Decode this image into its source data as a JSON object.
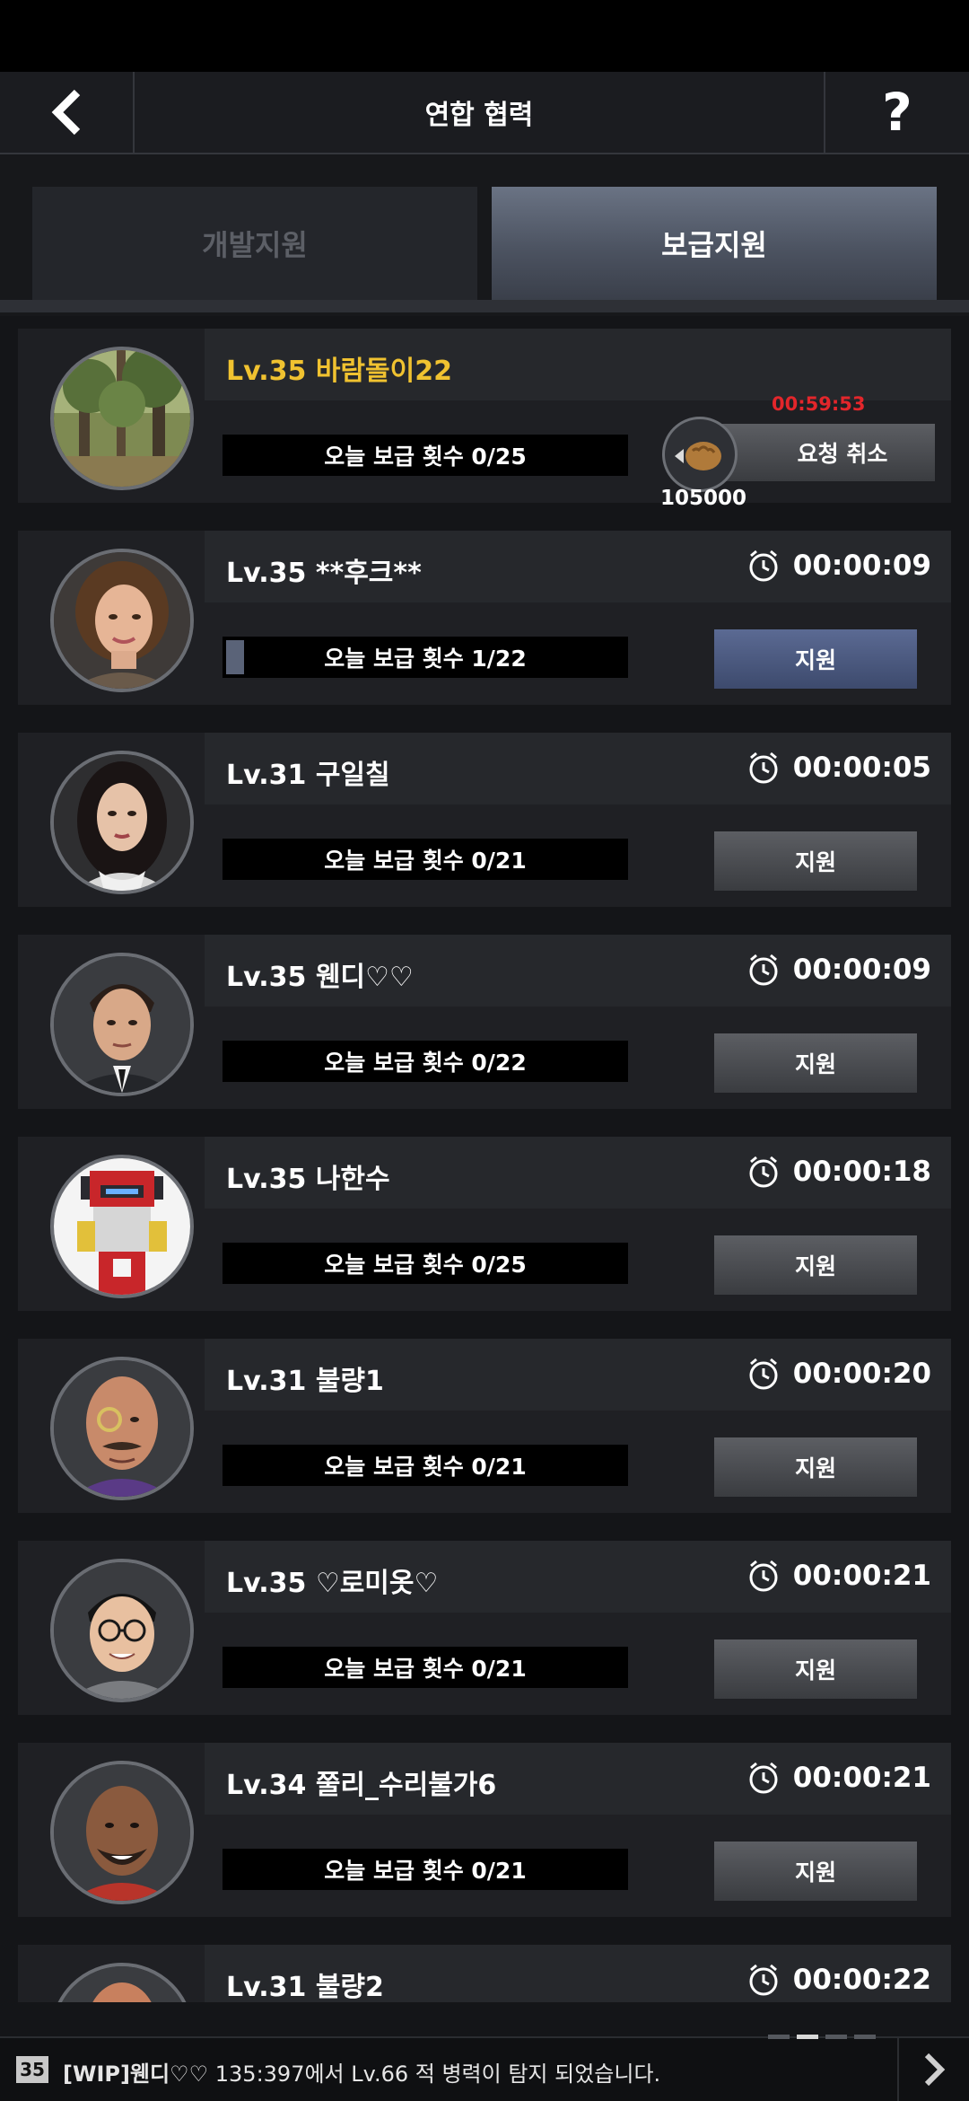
{
  "header": {
    "title": "연합 협력",
    "help_label": "?"
  },
  "tabs": [
    {
      "label": "개발지원",
      "active": false
    },
    {
      "label": "보급지원",
      "active": true
    }
  ],
  "requests": [
    {
      "name": "Lv.35 바람돌이22",
      "highlight": true,
      "progress": "오늘 보급 횟수 0/25",
      "progress_fraction": 0,
      "countdown": "00:59:53",
      "resource_amount": "105000",
      "action": "요청 취소",
      "avatar": "forest-avatar"
    },
    {
      "name": "Lv.35 **후크**",
      "timer": "00:00:09",
      "progress": "오늘 보급 횟수 1/22",
      "progress_fraction": 0.045,
      "action": "지원",
      "action_style": "blue",
      "avatar": "woman-brown-hair-avatar"
    },
    {
      "name": "Lv.31 구일칠",
      "timer": "00:00:05",
      "progress": "오늘 보급 횟수 0/21",
      "progress_fraction": 0,
      "action": "지원",
      "avatar": "woman-dark-hair-avatar"
    },
    {
      "name": "Lv.35 웬디♡♡",
      "timer": "00:00:09",
      "progress": "오늘 보급 횟수 0/22",
      "progress_fraction": 0,
      "action": "지원",
      "avatar": "man-suit-avatar"
    },
    {
      "name": "Lv.35 나한수",
      "timer": "00:00:18",
      "progress": "오늘 보급 횟수 0/25",
      "progress_fraction": 0,
      "action": "지원",
      "avatar": "robot-avatar"
    },
    {
      "name": "Lv.31 불량1",
      "timer": "00:00:20",
      "progress": "오늘 보급 횟수 0/21",
      "progress_fraction": 0,
      "action": "지원",
      "avatar": "bald-monocle-man-avatar"
    },
    {
      "name": "Lv.35 ♡로미옷♡",
      "timer": "00:00:21",
      "progress": "오늘 보급 횟수 0/21",
      "progress_fraction": 0,
      "action": "지원",
      "avatar": "glasses-man-avatar"
    },
    {
      "name": "Lv.34 쭐리_수리불가6",
      "timer": "00:00:21",
      "progress": "오늘 보급 횟수 0/21",
      "progress_fraction": 0,
      "action": "지원",
      "avatar": "bearded-man-avatar"
    },
    {
      "name": "Lv.31 불량2",
      "timer": "00:00:22",
      "avatar": "bald-man-avatar"
    }
  ],
  "footer": {
    "level": "35",
    "sender": "[WIP]웬디♡♡",
    "message": "135:397에서 Lv.66 적 병력이 탐지 되었습니다."
  },
  "colors": {
    "highlight_name": "#f0c230",
    "countdown": "#e3262b",
    "active_tab": "#565e6d",
    "support_blue": "#4a5a84"
  }
}
